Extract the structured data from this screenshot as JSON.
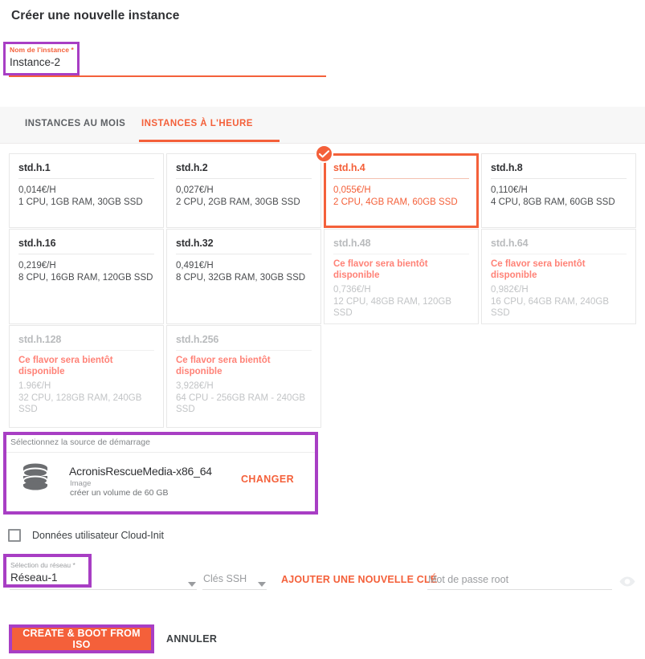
{
  "page": {
    "title": "Créer une nouvelle instance"
  },
  "colors": {
    "accent": "#f4603a",
    "highlight": "#a83ec4",
    "muted": "#9a9c9f",
    "soon": "#ff8277"
  },
  "instance_name": {
    "label": "Nom de l'instance *",
    "value": "Instance-2",
    "placeholder": "Nom de l'instance"
  },
  "tabs": [
    {
      "label": "INSTANCES AU MOIS",
      "active": false
    },
    {
      "label": "INSTANCES À L'HEURE",
      "active": true
    }
  ],
  "flavors": [
    {
      "name": "std.h.1",
      "price": "0,014€/H",
      "specs": "1 CPU, 1GB RAM, 30GB SSD",
      "selected": false,
      "available": true,
      "soon": ""
    },
    {
      "name": "std.h.2",
      "price": "0,027€/H",
      "specs": "2 CPU, 2GB RAM, 30GB SSD",
      "selected": false,
      "available": true,
      "soon": ""
    },
    {
      "name": "std.h.4",
      "price": "0,055€/H",
      "specs": "2 CPU, 4GB RAM, 60GB SSD",
      "selected": true,
      "available": true,
      "soon": ""
    },
    {
      "name": "std.h.8",
      "price": "0,110€/H",
      "specs": "4 CPU, 8GB RAM, 60GB SSD",
      "selected": false,
      "available": true,
      "soon": ""
    },
    {
      "name": "std.h.16",
      "price": "0,219€/H",
      "specs": "8 CPU, 16GB RAM, 120GB SSD",
      "selected": false,
      "available": true,
      "soon": ""
    },
    {
      "name": "std.h.32",
      "price": "0,491€/H",
      "specs": "8 CPU, 32GB RAM, 30GB SSD",
      "selected": false,
      "available": true,
      "soon": ""
    },
    {
      "name": "std.h.48",
      "price": "0,736€/H",
      "specs": "12 CPU, 48GB RAM, 120GB SSD",
      "selected": false,
      "available": false,
      "soon": "Ce flavor sera bientôt disponible"
    },
    {
      "name": "std.h.64",
      "price": "0,982€/H",
      "specs": "16 CPU, 64GB RAM, 240GB SSD",
      "selected": false,
      "available": false,
      "soon": "Ce flavor sera bientôt disponible"
    },
    {
      "name": "std.h.128",
      "price": "1.96€/H",
      "specs": "32 CPU, 128GB RAM, 240GB SSD",
      "selected": false,
      "available": false,
      "soon": "Ce flavor sera bientôt disponible"
    },
    {
      "name": "std.h.256",
      "price": "3,928€/H",
      "specs": "64 CPU - 256GB RAM - 240GB SSD",
      "selected": false,
      "available": false,
      "soon": "Ce flavor sera bientôt disponible"
    }
  ],
  "boot_source": {
    "label": "Sélectionnez la source de démarrage",
    "icon": "database-icon",
    "name": "AcronisRescueMedia-x86_64",
    "type": "Image",
    "volume": "créer un volume de 60 GB",
    "change_label": "CHANGER"
  },
  "cloud_init": {
    "label": "Données utilisateur Cloud-Init",
    "checked": false
  },
  "network": {
    "label": "Sélection du réseau *",
    "value": "Réseau-1"
  },
  "ssh": {
    "placeholder": "Clés SSH",
    "add_key_label": "AJOUTER UNE NOUVELLE CLÉ"
  },
  "root_password": {
    "placeholder": "Mot de passe root",
    "value": "",
    "reveal_icon": "eye-icon"
  },
  "footer": {
    "create_label": "CREATE & BOOT FROM ISO",
    "cancel_label": "ANNULER"
  }
}
